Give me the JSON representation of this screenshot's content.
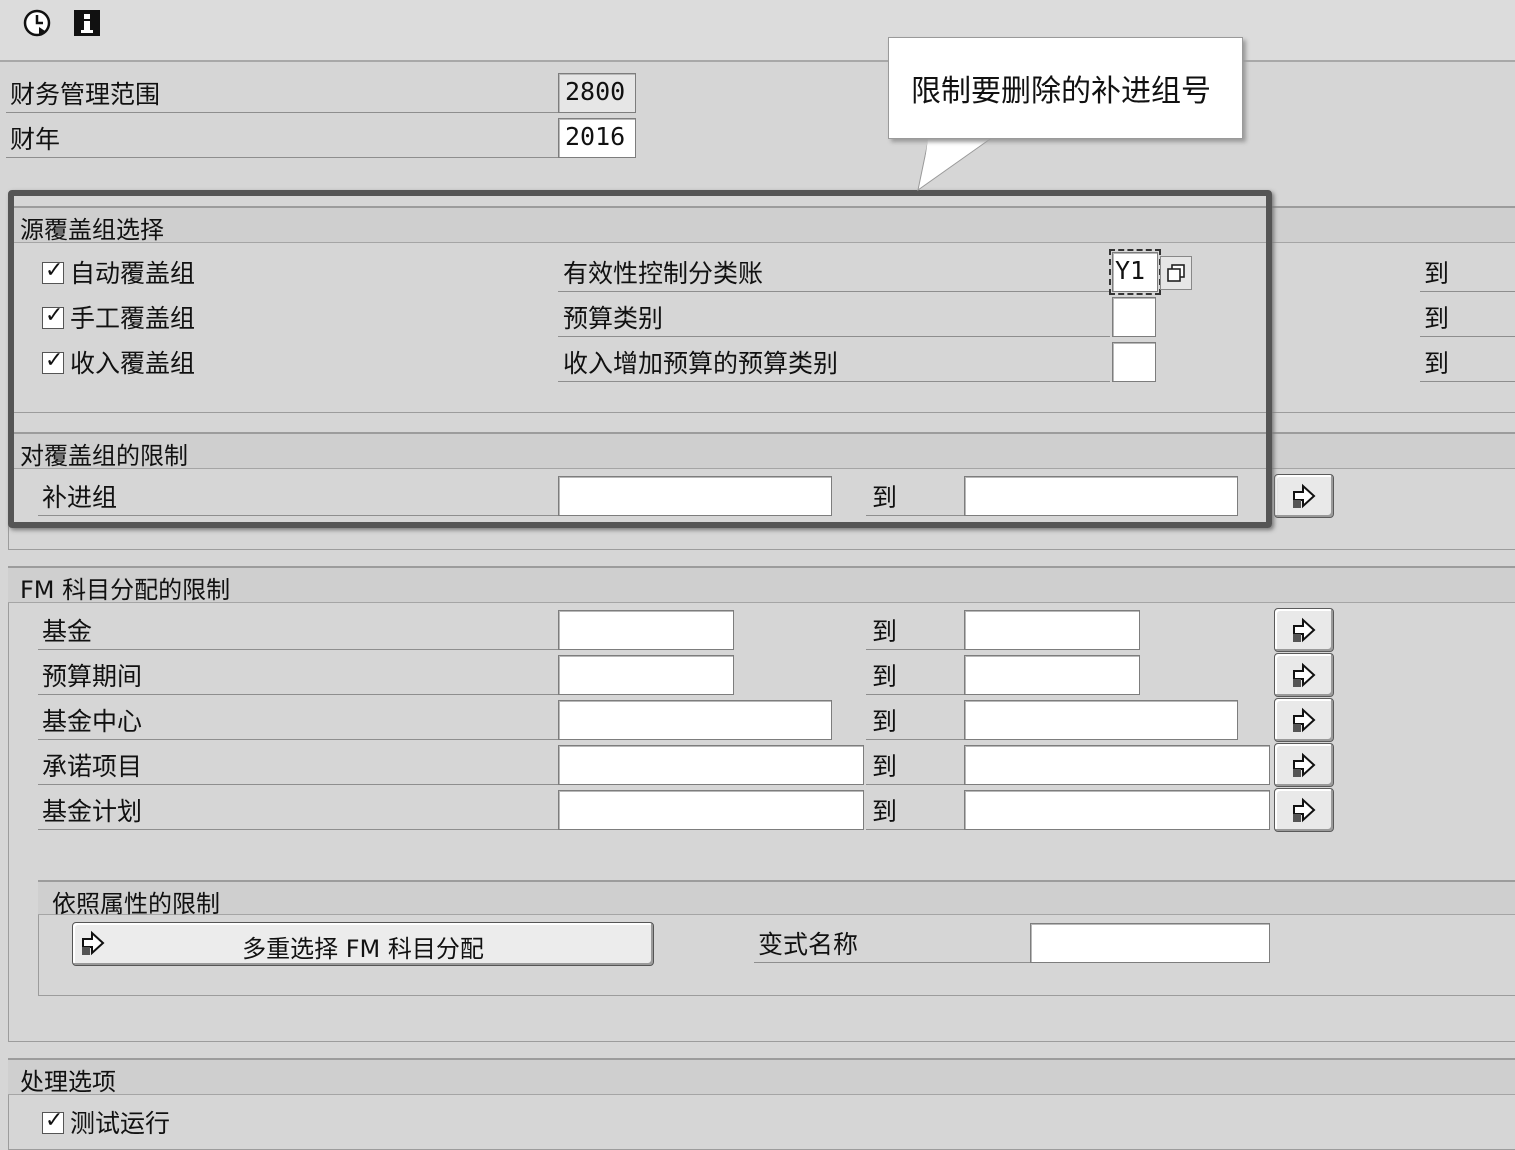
{
  "toolbar": {
    "execute_icon": "clock-execute-icon",
    "info_icon": "info-icon"
  },
  "header": {
    "fm_area_label": "财务管理范围",
    "fm_area_value": "2800",
    "fiscal_year_label": "财年",
    "fiscal_year_value": "2016"
  },
  "callout": {
    "text": "限制要删除的补进组号"
  },
  "source_section": {
    "title": "源覆盖组选择",
    "checks": [
      "自动覆盖组",
      "手工覆盖组",
      "收入覆盖组"
    ],
    "fields": [
      {
        "label": "有效性控制分类账",
        "value": "Y1"
      },
      {
        "label": "预算类别",
        "value": ""
      },
      {
        "label": "收入增加预算的预算类别",
        "value": ""
      }
    ],
    "to_label": "到"
  },
  "cover_section": {
    "title": "对覆盖组的限制",
    "rows": [
      {
        "label": "补进组",
        "to": "到"
      }
    ]
  },
  "fm_section": {
    "title": "FM 科目分配的限制",
    "rows": [
      {
        "label": "基金",
        "to": "到"
      },
      {
        "label": "预算期间",
        "to": "到"
      },
      {
        "label": "基金中心",
        "to": "到"
      },
      {
        "label": "承诺项目",
        "to": "到"
      },
      {
        "label": "基金计划",
        "to": "到"
      }
    ]
  },
  "attr_section": {
    "title": "依照属性的限制",
    "multi_select_button": "多重选择 FM 科目分配",
    "variant_label": "变式名称",
    "variant_value": ""
  },
  "processing_section": {
    "title": "处理选项",
    "test_run_label": "测试运行"
  }
}
